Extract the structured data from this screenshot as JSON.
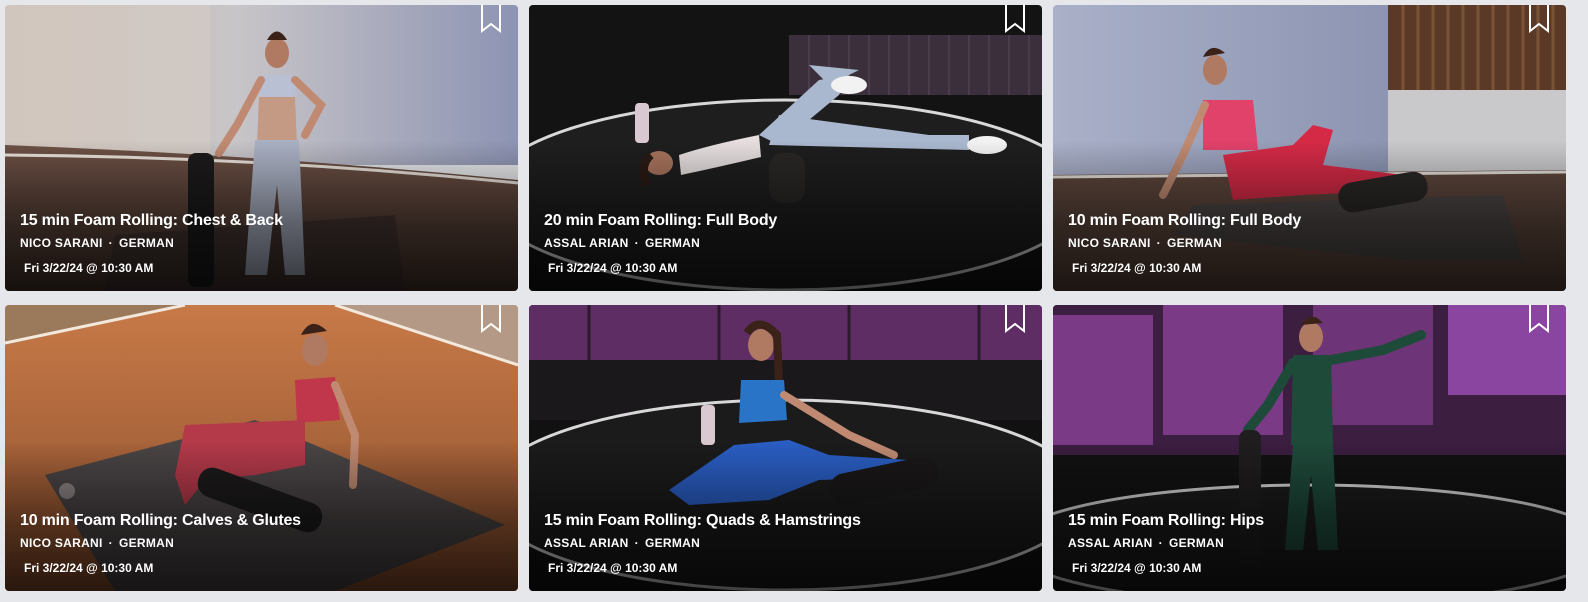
{
  "cards": [
    {
      "title": "15 min Foam Rolling: Chest & Back",
      "instructor": "NICO SARANI",
      "language": "GERMAN",
      "separator": "·",
      "date": "Fri 3/22/24 @ 10:30 AM",
      "bookmark_icon": "bookmark-outline-icon",
      "scene": "bright-studio"
    },
    {
      "title": "20 min Foam Rolling: Full Body",
      "instructor": "ASSAL ARIAN",
      "language": "GERMAN",
      "separator": "·",
      "date": "Fri 3/22/24 @ 10:30 AM",
      "bookmark_icon": "bookmark-outline-icon",
      "scene": "dark-studio"
    },
    {
      "title": "10 min Foam Rolling: Full Body",
      "instructor": "NICO SARANI",
      "language": "GERMAN",
      "separator": "·",
      "date": "Fri 3/22/24 @ 10:30 AM",
      "bookmark_icon": "bookmark-outline-icon",
      "scene": "bright-studio"
    },
    {
      "title": "10 min Foam Rolling: Calves & Glutes",
      "instructor": "NICO SARANI",
      "language": "GERMAN",
      "separator": "·",
      "date": "Fri 3/22/24 @ 10:30 AM",
      "bookmark_icon": "bookmark-outline-icon",
      "scene": "wood-studio"
    },
    {
      "title": "15 min Foam Rolling: Quads & Hamstrings",
      "instructor": "ASSAL ARIAN",
      "language": "GERMAN",
      "separator": "·",
      "date": "Fri 3/22/24 @ 10:30 AM",
      "bookmark_icon": "bookmark-outline-icon",
      "scene": "purple-studio"
    },
    {
      "title": "15 min Foam Rolling: Hips",
      "instructor": "ASSAL ARIAN",
      "language": "GERMAN",
      "separator": "·",
      "date": "Fri 3/22/24 @ 10:30 AM",
      "bookmark_icon": "bookmark-outline-icon",
      "scene": "purple-studio"
    }
  ],
  "colors": {
    "page_background": "#e6e7ea",
    "text": "#ffffff"
  }
}
